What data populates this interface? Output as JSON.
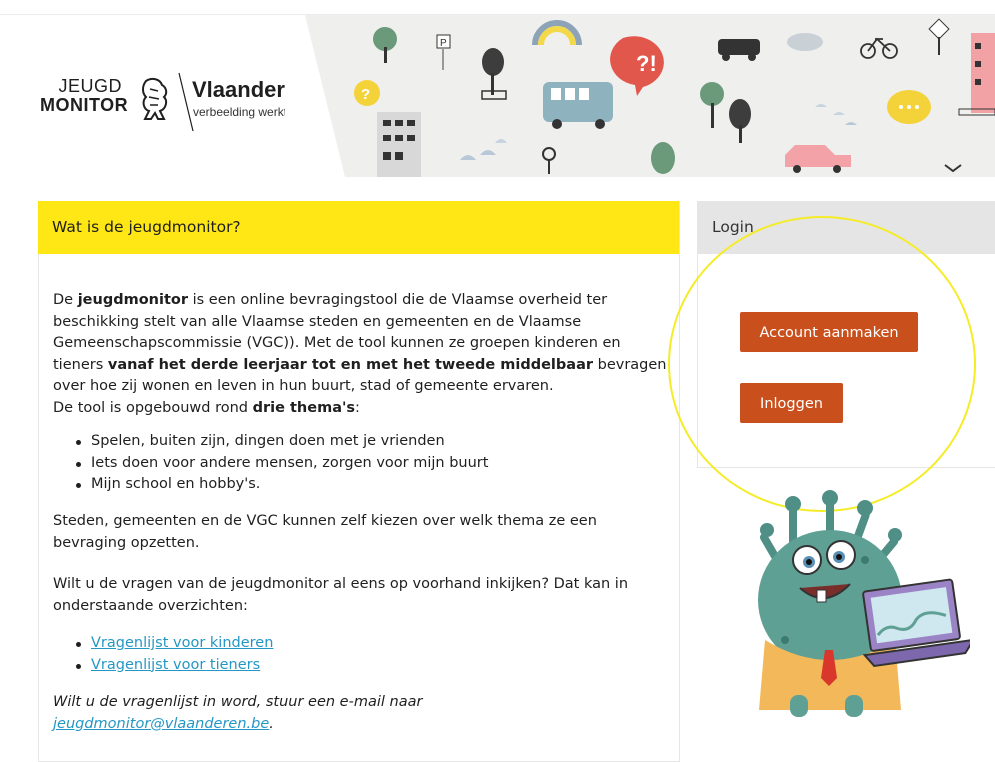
{
  "header": {
    "logo_jeugd_line1": "JEUGD",
    "logo_jeugd_line2": "MONITOR",
    "vlaanderen_name": "Vlaanderen",
    "vlaanderen_tagline": "verbeelding werkt",
    "banner_speech_text": "?!",
    "banner_sign_letter": "P"
  },
  "intro": {
    "title": "Wat is de jeugdmonitor?",
    "p1_a": "De ",
    "p1_b": "jeugdmonitor",
    "p1_c": " is een online bevragingstool die de Vlaamse overheid ter beschikking stelt van alle Vlaamse steden en gemeenten en de Vlaamse Gemeenschapscommissie (VGC)). Met de tool kunnen ze groepen kinderen en tieners ",
    "p1_d": "vanaf het derde leerjaar tot en met het tweede middelbaar",
    "p1_e": " bevragen over hoe zij wonen en leven in hun buurt, stad of gemeente ervaren.",
    "p1_f": "De tool is opgebouwd rond ",
    "p1_g": "drie thema's",
    "p1_h": ":",
    "themes": [
      "Spelen, buiten zijn, dingen doen met je vrienden",
      "Iets doen voor andere mensen, zorgen voor mijn buurt",
      "Mijn school en hobby's."
    ],
    "p2": "Steden, gemeenten en de VGC kunnen zelf kiezen over welk thema ze een bevraging opzetten.",
    "p3": "Wilt u de vragen van de jeugdmonitor al eens op voorhand inkijken? Dat kan in onderstaande overzichten:",
    "links": [
      "Vragenlijst voor kinderen",
      "Vragenlijst voor tieners"
    ],
    "p4_a": "Wilt u de vragenlijst in word, stuur een e-mail naar ",
    "p4_email": "jeugdmonitor@vlaanderen.be",
    "p4_b": "."
  },
  "login": {
    "title": "Login",
    "create_account_label": "Account aanmaken",
    "login_label": "Inloggen"
  },
  "colors": {
    "yellow": "#ffe615",
    "button_orange": "#c9501c",
    "link_blue": "#2597c4",
    "highlight_circle": "#f5ec28"
  }
}
